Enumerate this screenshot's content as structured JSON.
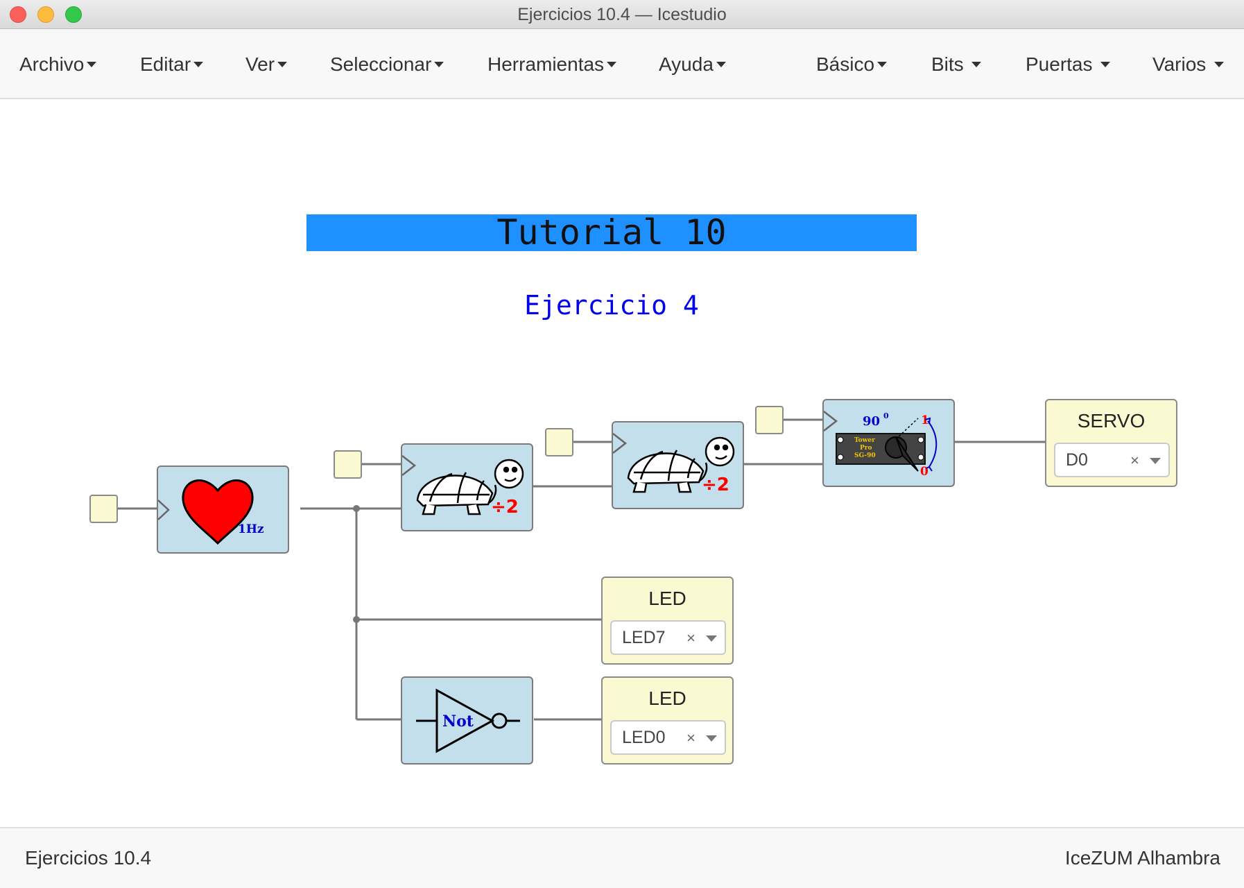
{
  "window": {
    "title": "Ejercicios 10.4 — Icestudio"
  },
  "menubar": {
    "left_menus": [
      "Archivo",
      "Editar",
      "Ver",
      "Seleccionar",
      "Herramientas",
      "Ayuda"
    ],
    "right_menus": [
      "Básico",
      "Bits",
      "Puertas",
      "Varios"
    ]
  },
  "canvas": {
    "banner": {
      "text": "Tutorial 10",
      "color": "#1e90ff"
    },
    "subtitle": {
      "text": "Ejercicio 4",
      "color": "#0000ee"
    },
    "blocks": {
      "heartbeat": {
        "label": "1Hz",
        "icon": "heart-icon"
      },
      "prescaler_1": {
        "label": "÷2",
        "icon": "turtle-icon"
      },
      "prescaler_2": {
        "label": "÷2",
        "icon": "turtle-icon"
      },
      "servo_driver": {
        "angle": "90",
        "degree": "0",
        "high": "1",
        "low": "0",
        "brand": [
          "Tower",
          "Pro",
          "SG-90"
        ],
        "icon": "servo-icon"
      },
      "not_gate": {
        "label": "Not",
        "icon": "not-gate-icon"
      }
    },
    "outputs": [
      {
        "title": "SERVO",
        "value": "D0"
      },
      {
        "title": "LED",
        "value": "LED7"
      },
      {
        "title": "LED",
        "value": "LED0"
      }
    ],
    "clear_glyph": "×"
  },
  "statusbar": {
    "left": "Ejercicios 10.4",
    "right": "IceZUM Alhambra"
  },
  "colors": {
    "block_fill": "#c3dfeb",
    "io_fill": "#fbf9d1",
    "wire": "#777777",
    "heart": "#ff0000",
    "label_blue": "#0000cc",
    "label_red": "#ff0000"
  }
}
